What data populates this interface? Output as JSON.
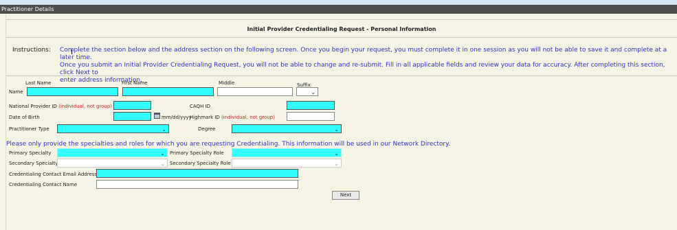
{
  "section_title": "Practitioner Details",
  "page_title": "Initial Provider Credentialing Request - Personal Information",
  "instructions": {
    "label": "Instructions:",
    "text": "Complete the section below and the address section on the following screen. Once you begin your request, you must complete it in one session as you will not be able to save it and complete at a later time.\nOnce you submit an Initial Provider Credentialing Request, you will not be able to change and re-submit. Fill in all applicable fields and review your data for accuracy. After completing this section, click Next to\nenter address information."
  },
  "name_row": {
    "label": "Name",
    "last_name_label": "Last Name",
    "first_name_label": "First Name",
    "middle_label": "Middle",
    "suffix_label": "Suffix"
  },
  "npi": {
    "label": "National Provider ID ",
    "note": "(individual, not group)"
  },
  "caqh": {
    "label": "CAQH ID"
  },
  "dob": {
    "label": "Date of Birth",
    "format_hint": "mm/dd/yyyy"
  },
  "highmark": {
    "label": "Highmark ID ",
    "note": "(individual, not group)"
  },
  "practitioner_type": {
    "label": "Practitioner Type"
  },
  "degree": {
    "label": "Degree"
  },
  "specialty_note": "Please only provide the specialties and roles for which you are requesting Credentialing. This information will be used in our Network Directory.",
  "primary_specialty": {
    "label": "Primary Specialty"
  },
  "primary_specialty_role": {
    "label": "Primary Specialty Role"
  },
  "secondary_specialty": {
    "label": "Secondary Specialty"
  },
  "secondary_specialty_role": {
    "label": "Secondary Specialty Role"
  },
  "contact_email": {
    "label": "Credentialing Contact Email Address"
  },
  "contact_name": {
    "label": "Credentialing Contact Name"
  },
  "next_button": "Next",
  "colors": {
    "required_field": "#33ffff",
    "header_bg": "#4e4e4e",
    "instruction_text": "#3333cc",
    "note_red": "#cc2222"
  }
}
